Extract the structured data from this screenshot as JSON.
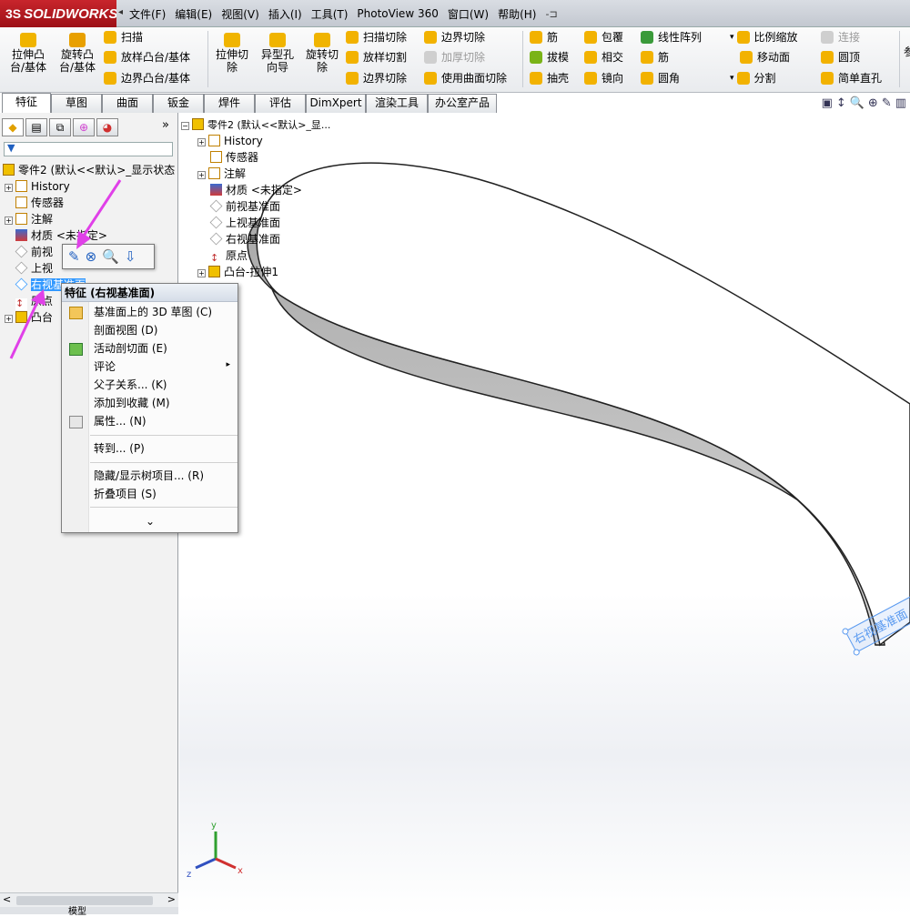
{
  "app": {
    "logo_text": "SOLIDWORKS",
    "logo_ds": "3S"
  },
  "menu": {
    "items": [
      "文件(F)",
      "编辑(E)",
      "视图(V)",
      "插入(I)",
      "工具(T)",
      "PhotoView 360",
      "窗口(W)",
      "帮助(H)"
    ],
    "pin": "-⊐"
  },
  "command_manager": {
    "big_buttons": [
      "拉伸凸台/基体",
      "旋转凸台/基体",
      "拉伸切除",
      "异型孔向导",
      "旋转切除"
    ],
    "group1": [
      "扫描",
      "放样凸台/基体",
      "边界凸台/基体"
    ],
    "group2a": [
      "扫描切除",
      "放样切割",
      "边界切除"
    ],
    "group2b": [
      "边界切除",
      "加厚切除",
      "使用曲面切除"
    ],
    "group3a": [
      "筋",
      "拔模",
      "抽壳"
    ],
    "group3b": [
      "包覆",
      "相交",
      "镜向"
    ],
    "group3c": [
      "线性阵列",
      "筋",
      "圆角"
    ],
    "group4": [
      "比例缩放",
      "移动面",
      "分割"
    ],
    "group5": [
      "连接",
      "圆顶",
      "简单直孔"
    ],
    "overflow": "参"
  },
  "tabs": [
    "特征",
    "草图",
    "曲面",
    "钣金",
    "焊件",
    "评估",
    "DimXpert",
    "渲染工具",
    "办公室产品"
  ],
  "left_tree": {
    "root": "零件2 (默认<<默认>_显示状态",
    "items": [
      "History",
      "传感器",
      "注解",
      "材质 <未指定>",
      "前视",
      "上视",
      "右视基准面",
      "原点",
      "凸台"
    ],
    "bottom_tab": "模型"
  },
  "float_tree": {
    "root": "零件2 (默认<<默认>_显...",
    "items": [
      "History",
      "传感器",
      "注解",
      "材质 <未指定>",
      "前视基准面",
      "上视基准面",
      "右视基准面",
      "原点",
      "凸台-拉伸1"
    ]
  },
  "context_menu": {
    "title": "特征 (右视基准面)",
    "items": [
      {
        "label": "基准面上的 3D 草图 (C)"
      },
      {
        "label": "剖面视图 (D)"
      },
      {
        "label": "活动剖切面 (E)"
      },
      {
        "label": "评论"
      },
      {
        "label": "父子关系... (K)"
      },
      {
        "label": "添加到收藏 (M)"
      },
      {
        "label": "属性... (N)"
      },
      {
        "label": "转到... (P)"
      },
      {
        "label": "隐藏/显示树项目... (R)"
      },
      {
        "label": "折叠项目 (S)"
      }
    ],
    "more": "⌄"
  },
  "viewport": {
    "plane_label": "右视基准面",
    "axes": {
      "x": "x",
      "y": "y",
      "z": "z"
    }
  },
  "colors": {
    "accent_red": "#b3181f",
    "selection_blue": "#3399ff",
    "annotation_magenta": "#e040e8"
  }
}
